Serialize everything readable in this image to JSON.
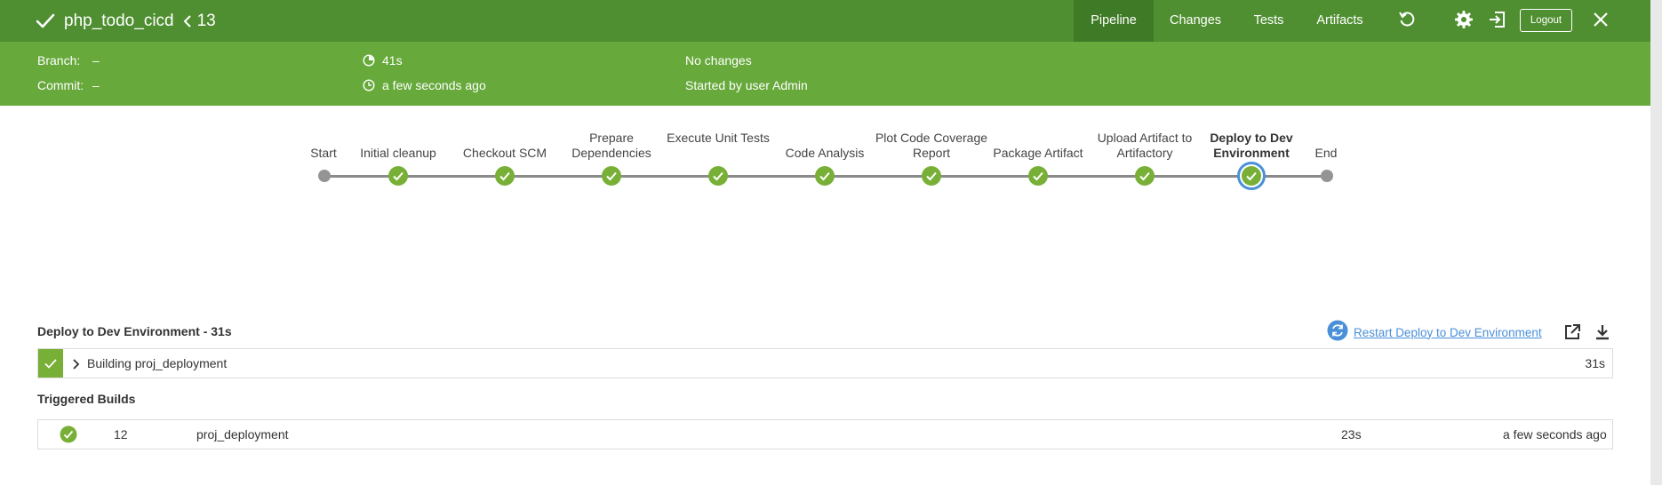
{
  "header": {
    "title": "php_todo_cicd",
    "run_number": "13",
    "tabs": [
      "Pipeline",
      "Changes",
      "Tests",
      "Artifacts"
    ],
    "active_tab": "Pipeline",
    "logout_label": "Logout",
    "icons": [
      "check-icon",
      "chevron-left-icon",
      "replay-icon",
      "gear-icon",
      "sign-out-icon",
      "close-icon"
    ]
  },
  "summary": {
    "branch_label": "Branch:",
    "branch_value": "–",
    "commit_label": "Commit:",
    "commit_value": "–",
    "duration": "41s",
    "started_ago": "a few seconds ago",
    "changes": "No changes",
    "started_by": "Started by user Admin"
  },
  "pipeline": {
    "stages": [
      {
        "label": "Start",
        "status": "start"
      },
      {
        "label": "Initial cleanup",
        "status": "success"
      },
      {
        "label": "Checkout SCM",
        "status": "success"
      },
      {
        "label": "Prepare Dependencies",
        "status": "success"
      },
      {
        "label": "Execute Unit Tests",
        "status": "success"
      },
      {
        "label": "Code Analysis",
        "status": "success"
      },
      {
        "label": "Plot Code Coverage Report",
        "status": "success"
      },
      {
        "label": "Package Artifact",
        "status": "success"
      },
      {
        "label": "Upload Artifact to Artifactory",
        "status": "success"
      },
      {
        "label": "Deploy to Dev Environment",
        "status": "success",
        "selected": true
      },
      {
        "label": "End",
        "status": "end"
      }
    ]
  },
  "detail": {
    "step_title": "Deploy to Dev Environment - 31s",
    "restart_label": "Restart Deploy to Dev Environment",
    "log_step": "Building proj_deployment",
    "log_duration": "31s"
  },
  "triggered": {
    "title": "Triggered Builds",
    "rows": [
      {
        "number": "12",
        "name": "proj_deployment",
        "duration": "23s",
        "when": "a few seconds ago"
      }
    ]
  },
  "colors": {
    "header_bg": "#4f8f31",
    "active_tab_bg": "#3f7a26",
    "summary_bg": "#67a93b",
    "success": "#78b037",
    "selected_ring": "#4a90d9",
    "link": "#4a90d9"
  }
}
